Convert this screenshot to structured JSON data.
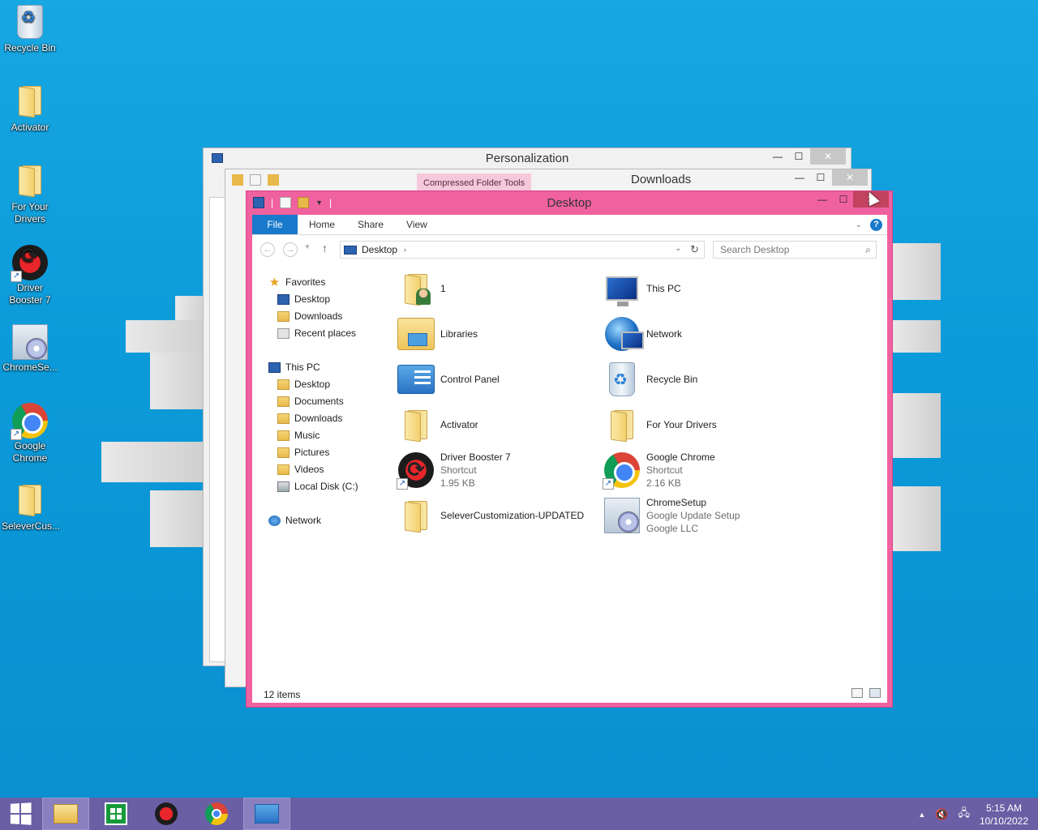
{
  "desktop": {
    "icons": [
      {
        "label": "Recycle Bin",
        "icon": "recycle-bin-icon"
      },
      {
        "label": "Activator",
        "icon": "folder-icon"
      },
      {
        "label": "For Your Drivers",
        "icon": "folder-icon"
      },
      {
        "label": "Driver Booster 7",
        "icon": "driver-booster-icon"
      },
      {
        "label": "ChromeSe...",
        "icon": "setup-icon"
      },
      {
        "label": "Google Chrome",
        "icon": "chrome-icon"
      },
      {
        "label": "SeleverCus...",
        "icon": "folder-icon"
      }
    ]
  },
  "windows": {
    "personalization": {
      "title": "Personalization"
    },
    "downloads": {
      "title": "Downloads",
      "contextual_tab": "Compressed Folder Tools"
    },
    "desktop": {
      "title": "Desktop",
      "ribbon_tabs": [
        "File",
        "Home",
        "Share",
        "View"
      ],
      "address": "Desktop",
      "search_placeholder": "Search Desktop",
      "nav": {
        "favorites": "Favorites",
        "fav_items": [
          "Desktop",
          "Downloads",
          "Recent places"
        ],
        "this_pc": "This PC",
        "pc_items": [
          "Desktop",
          "Documents",
          "Downloads",
          "Music",
          "Pictures",
          "Videos",
          "Local Disk (C:)"
        ],
        "network": "Network"
      },
      "items": [
        {
          "name": "1",
          "line2": "",
          "line3": ""
        },
        {
          "name": "This PC",
          "line2": "",
          "line3": ""
        },
        {
          "name": "Libraries",
          "line2": "",
          "line3": ""
        },
        {
          "name": "Network",
          "line2": "",
          "line3": ""
        },
        {
          "name": "Control Panel",
          "line2": "",
          "line3": ""
        },
        {
          "name": "Recycle Bin",
          "line2": "",
          "line3": ""
        },
        {
          "name": "Activator",
          "line2": "",
          "line3": ""
        },
        {
          "name": "For Your Drivers",
          "line2": "",
          "line3": ""
        },
        {
          "name": "Driver Booster 7",
          "line2": "Shortcut",
          "line3": "1.95 KB"
        },
        {
          "name": "Google Chrome",
          "line2": "Shortcut",
          "line3": "2.16 KB"
        },
        {
          "name": "SeleverCustomization-UPDATED",
          "line2": "",
          "line3": ""
        },
        {
          "name": "ChromeSetup",
          "line2": "Google Update Setup",
          "line3": "Google LLC"
        }
      ],
      "status": "12 items"
    }
  },
  "taskbar": {
    "time": "5:15 AM",
    "date": "10/10/2022"
  },
  "colors": {
    "window_frame": "#f0619f",
    "file_tab": "#1979ca",
    "taskbar": "#6a5fa5"
  }
}
